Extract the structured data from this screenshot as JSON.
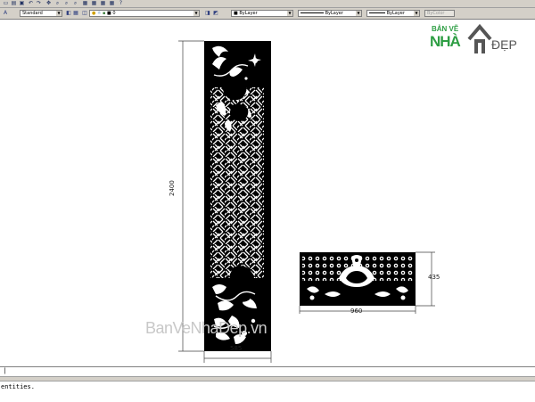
{
  "toolbar": {
    "text_style": "Standard",
    "layer": "0",
    "color": "ByLayer",
    "linetype": "ByLayer",
    "lineweight": "ByLayer",
    "plotstyle": "ByColor"
  },
  "drawing": {
    "panel_tall": {
      "height_dim": "2400",
      "width_dim": "585"
    },
    "panel_wide": {
      "height_dim": "435",
      "width_dim": "960"
    }
  },
  "command_line": {
    "text": "entities."
  },
  "overlay": {
    "watermark": "BanVeNhaDep.vn",
    "logo_top": "BẢN VẼ",
    "logo_nha": "NHÀ",
    "logo_dep": "ĐẸP"
  },
  "colors": {
    "toolbar_bg": "#d4d0c8",
    "logo_green": "#2e9e44",
    "logo_gray": "#555555",
    "cad_black": "#000000"
  }
}
